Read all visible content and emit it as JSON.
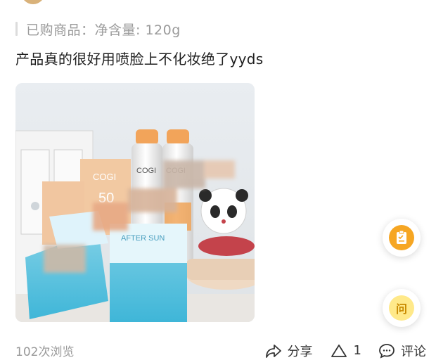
{
  "purchase": {
    "text": "已购商品：净含量: 120g"
  },
  "review": {
    "text": "产品真的很好用喷脸上不化妆绝了yyds"
  },
  "photo": {
    "brand_text": "COGI",
    "spf_text": "50",
    "product_text": "AFTER SUN"
  },
  "floating": {
    "ask_label": "问"
  },
  "footer": {
    "views": "102次浏览",
    "share_label": "分享",
    "like_count": "1",
    "comment_label": "评论"
  },
  "colors": {
    "accent": "#f6a623",
    "ask_bg": "#ffe98a",
    "muted": "#9a9a9a"
  }
}
